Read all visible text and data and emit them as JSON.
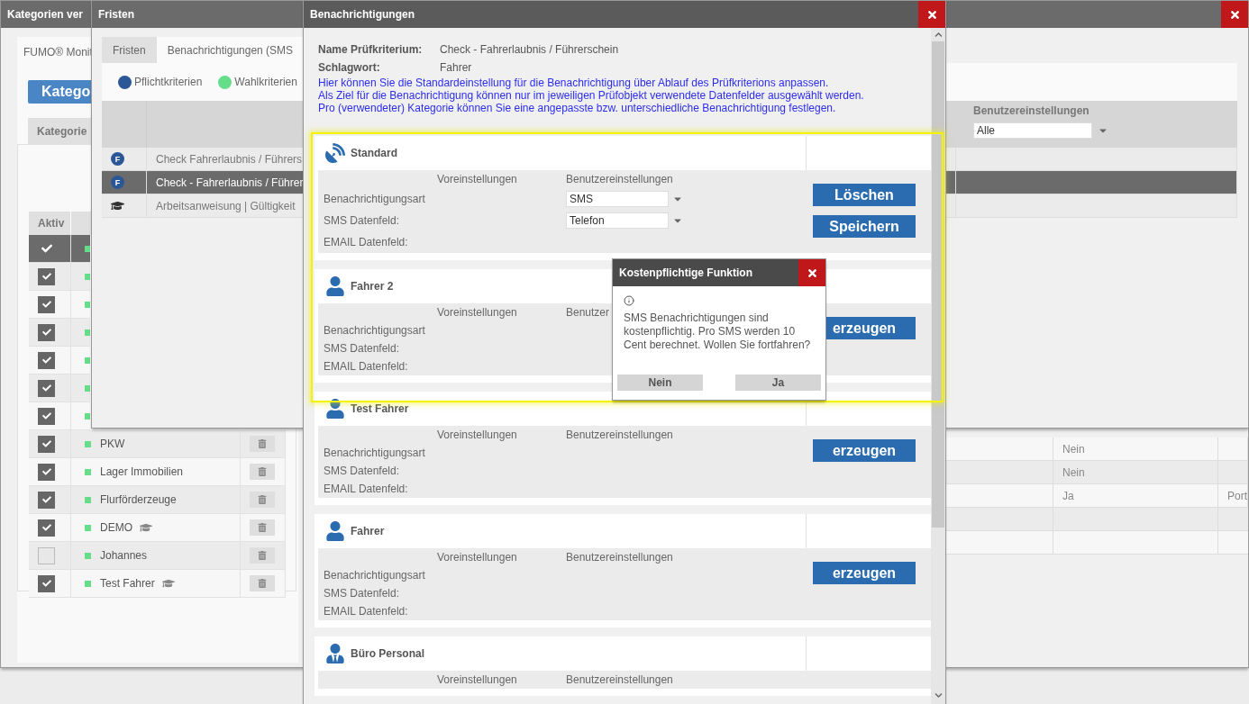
{
  "back_window": {
    "title": "Kategorien ver",
    "brand": "FUMO® Monit",
    "primary_button": "Katego",
    "tab": "Kategorie",
    "column_1": "Aktiv",
    "rows": [
      {
        "checked": true,
        "selected": true
      },
      {
        "checked": true,
        "selected": false
      },
      {
        "checked": true,
        "selected": false
      },
      {
        "checked": true,
        "selected": false
      },
      {
        "checked": true,
        "selected": false
      },
      {
        "checked": true,
        "selected": false
      },
      {
        "checked": true,
        "selected": false
      },
      {
        "checked": true,
        "selected": false,
        "name": "PKW",
        "training": false
      },
      {
        "checked": true,
        "selected": false,
        "name": "Lager Immobilien",
        "training": false
      },
      {
        "checked": true,
        "selected": false,
        "name": "Flurförderzeuge",
        "training": false
      },
      {
        "checked": true,
        "selected": false,
        "name": "DEMO",
        "training": true
      },
      {
        "checked": false,
        "selected": false,
        "name": "Johannes",
        "training": false
      },
      {
        "checked": true,
        "selected": false,
        "name": "Test Fahrer",
        "training": true
      }
    ],
    "side_table": [
      {
        "column_2": "Nein"
      },
      {
        "column_2": "Nein"
      },
      {
        "column_2": "Ja",
        "column_3": "Port"
      }
    ]
  },
  "deadlines_window": {
    "title": "Fristen",
    "tabs": [
      {
        "label": "Fristen",
        "selected": false
      },
      {
        "label": "Benachrichtigungen (SMS",
        "selected": true
      }
    ],
    "legend": [
      {
        "label": "Pflichtkriterien",
        "color": "#2b5797"
      },
      {
        "label": "Wahlkriterien",
        "color": "#66dd88"
      }
    ],
    "column_3": "Benutzereinstellungen",
    "filter": "Alle",
    "rows": [
      {
        "kind": "mandatory",
        "badge": "F",
        "label": "Check Fahrerlaubnis / Führers",
        "selected": false
      },
      {
        "kind": "mandatory",
        "badge": "F",
        "label": "Check - Fahrerlaubnis / Führer",
        "selected": true
      },
      {
        "kind": "instruction",
        "label": "Arbeitsanweisung | Gültigkeit",
        "selected": false
      }
    ]
  },
  "notifications_window": {
    "title": "Benachrichtigungen",
    "info": [
      {
        "label": "Name Prüfkriterium:",
        "value": "Check - Fahrerlaubnis / Führerschein"
      },
      {
        "label": "Schlagwort:",
        "value": "Fahrer"
      }
    ],
    "notes": [
      "Hier können Sie die Standardeinstellung für die Benachrichtigung über Ablauf des Prüfkriterions anpassen.",
      "Als Ziel für die Benachrichtigung können nur im jeweiligen Prüfobjekt verwendete Datenfelder ausgewählt werden.",
      "Pro (verwendeter) Kategorie können Sie eine angepasste bzw. unterschiedliche Benachrichtigung festlegen."
    ],
    "cards": [
      {
        "kind": "standard",
        "name": "Standard",
        "columns": [
          "Voreinstellungen",
          "Benutzereinstellungen"
        ],
        "fields": [
          {
            "label": "Benachrichtigungsart",
            "value": "SMS"
          },
          {
            "label": "SMS Datenfeld:",
            "value": "Telefon"
          },
          {
            "label": "EMAIL Datenfeld:"
          }
        ],
        "buttons": [
          "Löschen",
          "Speichern"
        ]
      },
      {
        "kind": "person",
        "name": "Fahrer 2",
        "columns": [
          "Voreinstellungen",
          "Benutzer"
        ],
        "fields": [
          {
            "label": "Benachrichtigungsart"
          },
          {
            "label": "SMS Datenfeld:"
          },
          {
            "label": "EMAIL Datenfeld:"
          }
        ],
        "buttons": [
          "erzeugen"
        ]
      },
      {
        "kind": "person",
        "name": "Test Fahrer",
        "columns": [
          "Voreinstellungen",
          "Benutzereinstellungen"
        ],
        "fields": [
          {
            "label": "Benachrichtigungsart"
          },
          {
            "label": "SMS Datenfeld:"
          },
          {
            "label": "EMAIL Datenfeld:"
          }
        ],
        "buttons": [
          "erzeugen"
        ]
      },
      {
        "kind": "person",
        "name": "Fahrer",
        "columns": [
          "Voreinstellungen",
          "Benutzereinstellungen"
        ],
        "fields": [
          {
            "label": "Benachrichtigungsart"
          },
          {
            "label": "SMS Datenfeld:"
          },
          {
            "label": "EMAIL Datenfeld:"
          }
        ],
        "buttons": [
          "erzeugen"
        ]
      },
      {
        "kind": "staff",
        "name": "Büro Personal",
        "columns": [
          "Voreinstellungen",
          "Benutzereinstellungen"
        ]
      }
    ]
  },
  "dialog": {
    "title": "Kostenpflichtige Funktion",
    "message": "SMS Benachrichtigungen sind kostenpflichtig. Pro SMS werden 10 Cent berechnet. Wollen Sie fortfahren?",
    "buttons": [
      "Nein",
      "Ja"
    ]
  }
}
